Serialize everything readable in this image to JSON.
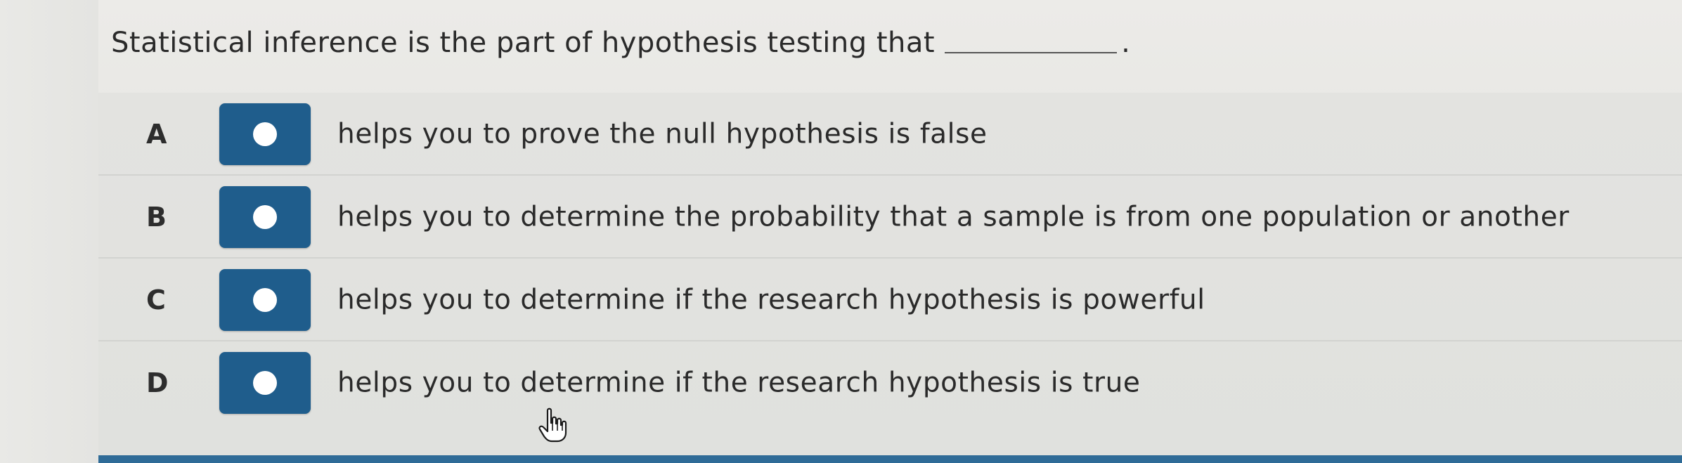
{
  "question": {
    "text": "Statistical inference is the part of hypothesis testing that",
    "end_punct": "."
  },
  "options": [
    {
      "letter": "A",
      "text": "helps you to prove the null hypothesis is false"
    },
    {
      "letter": "B",
      "text": "helps you to determine the probability that a sample is from one population or another"
    },
    {
      "letter": "C",
      "text": "helps you to determine if the research hypothesis is powerful"
    },
    {
      "letter": "D",
      "text": "helps you to determine if the research hypothesis is true"
    }
  ],
  "colors": {
    "radio_button_bg": "#1f5d8c",
    "radio_dot": "#ffffff",
    "accent_bar": "#2f6b97"
  },
  "icons": {
    "cursor": "hand-pointer-icon"
  }
}
